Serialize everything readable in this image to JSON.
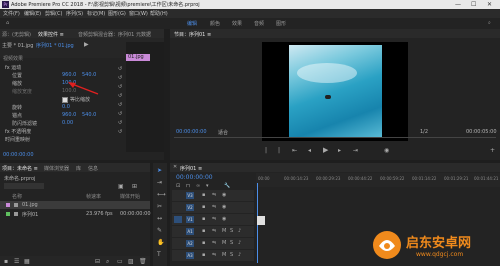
{
  "window": {
    "title": "Adobe Premiere Pro CC 2018 - F:\\影视剪辑\\视频\\premiere\\工作区\\未命名.prproj",
    "minimize": "—",
    "maximize": "☐",
    "close": "✕"
  },
  "menu": [
    "文件(F)",
    "编辑(E)",
    "剪辑(C)",
    "序列(S)",
    "标记(M)",
    "图形(G)",
    "窗口(W)",
    "帮助(H)"
  ],
  "workspaces": {
    "items": [
      "编辑",
      "颜色",
      "效果",
      "音频",
      "图形"
    ],
    "active": "编辑"
  },
  "effect_controls": {
    "tabs": [
      "源：(无剪辑)",
      "效果控件 ≡",
      "音频剪辑混合器：序列01",
      "元数据"
    ],
    "source": "主要 * 01.jpg",
    "sequence": "序列01 * 01.jpg",
    "clip_label": "01.jpg",
    "section_video": "视频效果",
    "motion": "fx 运动",
    "position_label": "位置",
    "position_x": "960.0",
    "position_y": "540.0",
    "scale_label": "缩放",
    "scale_value": "100.0",
    "scale_width_label": "缩放宽度",
    "scale_width_value": "100.0",
    "uniform_label": "等比缩放",
    "rotation_label": "旋转",
    "rotation_value": "0.0",
    "anchor_label": "锚点",
    "anchor_x": "960.0",
    "anchor_y": "540.0",
    "flicker_label": "防闪烁滤镜",
    "flicker_value": "0.00",
    "opacity": "fx 不透明度",
    "time_remap": "时间重映射",
    "timecode": "00:00:00:00"
  },
  "program_monitor": {
    "title": "节目：序列01 ≡",
    "timecode": "00:00:00:00",
    "fit": "适合",
    "quality": "1/2",
    "duration": "00:00:05:00"
  },
  "project": {
    "tabs": [
      "项目：未命名 ≡",
      "媒体浏览器",
      "库",
      "信息"
    ],
    "file": "未命名.prproj",
    "col_name": "名称",
    "col_rate": "帧速率",
    "col_media_start": "媒体开始",
    "items": [
      {
        "name": "01.jpg",
        "rate": "",
        "start": ""
      },
      {
        "name": "序列01",
        "rate": "23.976 fps",
        "start": "00:00:00:00"
      }
    ]
  },
  "timeline": {
    "title": "序列01 ≡",
    "timecode": "00:00:00:00",
    "ruler": [
      "00:00",
      "00:00:14:23",
      "00:00:29:23",
      "00:00:44:22",
      "00:00:59:22",
      "00:01:14:22",
      "00:01:29:21",
      "00:01:44:21"
    ],
    "tracks": [
      "V3",
      "V2",
      "V1",
      "A1",
      "A2",
      "A3"
    ]
  },
  "watermark": {
    "text": "启东安卓网",
    "url": "www.qdgcj.com"
  }
}
